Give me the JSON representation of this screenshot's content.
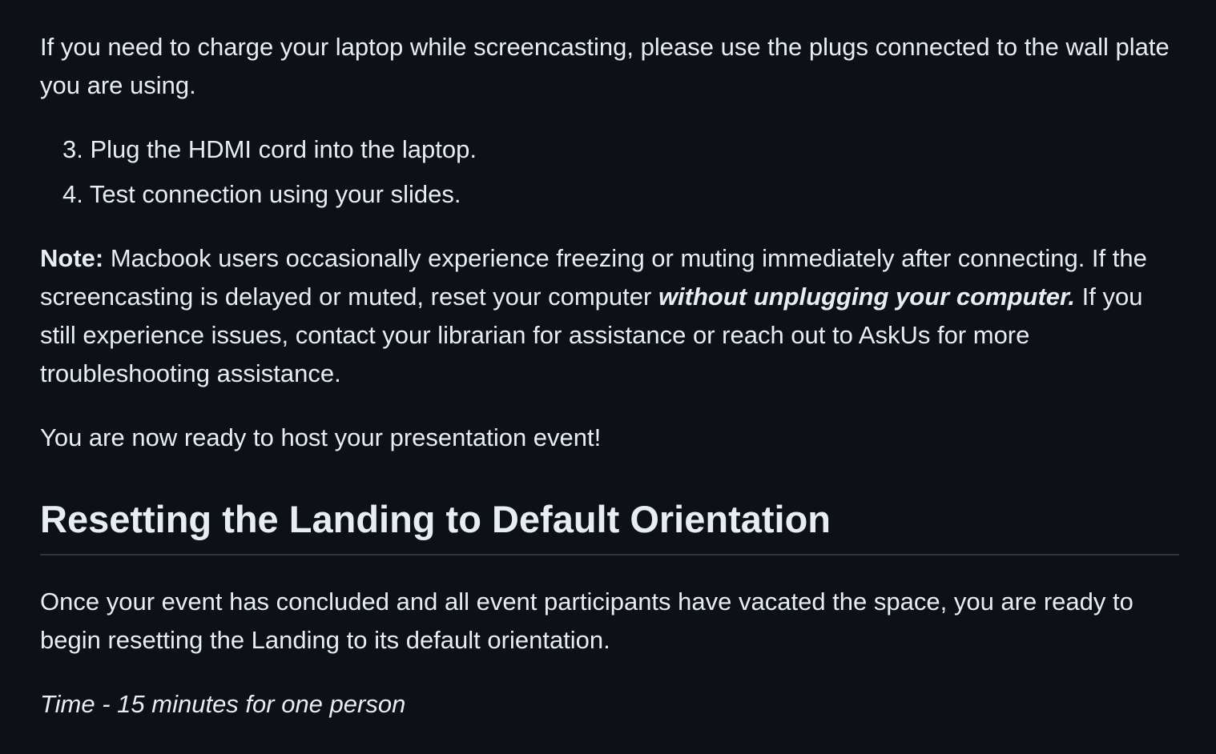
{
  "article": {
    "intro": "If you need to charge your laptop while screencasting, please use the plugs connected to the wall plate you are using.",
    "steps": [
      "3. Plug the HDMI cord into the laptop.",
      "4. Test connection using your slides."
    ],
    "note": {
      "label": "Note:",
      "text_before": " Macbook users occasionally experience freezing or muting immediately after connecting. If the screencasting is delayed or muted, reset your computer ",
      "emphasis": "without unplugging your computer.",
      "text_after": " If you still experience issues, contact your librarian for assistance or reach out to AskUs for more troubleshooting assistance."
    },
    "ready": "You are now ready to host your presentation event!",
    "section_heading": "Resetting the Landing to Default Orientation",
    "concluded": "Once your event has concluded and all event participants have vacated the space, you are ready to begin resetting the Landing to its default orientation.",
    "time": "Time - 15 minutes for one person"
  }
}
